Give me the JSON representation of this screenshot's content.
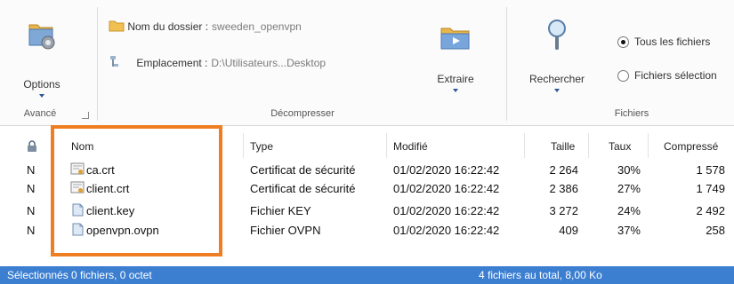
{
  "ribbon": {
    "options_label": "Options",
    "avance_label": "Avancé",
    "folder_name_label": "Nom du dossier :",
    "folder_name_value": "sweeden_openvpn",
    "location_label": "Emplacement :",
    "location_value": "D:\\Utilisateurs...Desktop",
    "extract_label": "Extraire",
    "decompress_group": "Décompresser",
    "search_label": "Rechercher",
    "radio_all": "Tous les fichiers",
    "radio_selected": "Fichiers sélection",
    "files_group": "Fichiers"
  },
  "table": {
    "headers": {
      "name": "Nom",
      "type": "Type",
      "modified": "Modifié",
      "size": "Taille",
      "ratio": "Taux",
      "compressed": "Compressé"
    },
    "rows": [
      {
        "flag": "N",
        "name": "ca.crt",
        "type": "Certificat de sécurité",
        "modified": "01/02/2020 16:22:42",
        "size": "2 264",
        "ratio": "30%",
        "compressed": "1 578",
        "icon": "certificate-file-icon"
      },
      {
        "flag": "N",
        "name": "client.crt",
        "type": "Certificat de sécurité",
        "modified": "01/02/2020 16:22:42",
        "size": "2 386",
        "ratio": "27%",
        "compressed": "1 749",
        "icon": "certificate-file-icon"
      },
      {
        "flag": "N",
        "name": "client.key",
        "type": "Fichier KEY",
        "modified": "01/02/2020 16:22:42",
        "size": "3 272",
        "ratio": "24%",
        "compressed": "2 492",
        "icon": "generic-file-icon"
      },
      {
        "flag": "N",
        "name": "openvpn.ovpn",
        "type": "Fichier OVPN",
        "modified": "01/02/2020 16:22:42",
        "size": "409",
        "ratio": "37%",
        "compressed": "258",
        "icon": "generic-file-icon"
      }
    ]
  },
  "status": {
    "selected": "Sélectionnés 0 fichiers, 0 octet",
    "total": "4 fichiers au total, 8,00 Ko"
  },
  "colors": {
    "highlight": "#ef7d22",
    "statusbar": "#3c7fd1",
    "accent": "#2b5797"
  },
  "icons": {
    "options": "gear-folder-icon",
    "folder": "folder-icon",
    "location": "location-icon",
    "extract": "extract-folder-icon",
    "search": "magnifier-icon",
    "attributes": "lock-icon"
  }
}
